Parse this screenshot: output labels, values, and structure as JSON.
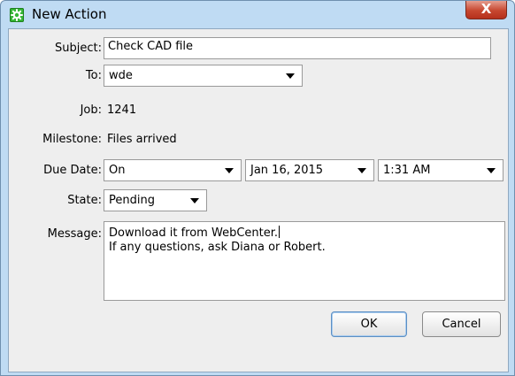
{
  "window": {
    "title": "New Action",
    "close_label": "X"
  },
  "form": {
    "subject": {
      "label": "Subject:",
      "value": "Check CAD file"
    },
    "to": {
      "label": "To:",
      "value": "wde"
    },
    "job": {
      "label": "Job:",
      "value": "1241"
    },
    "milestone": {
      "label": "Milestone:",
      "value": "Files arrived"
    },
    "due_date": {
      "label": "Due Date:",
      "mode": "On",
      "date": "Jan 16, 2015",
      "time": "1:31 AM"
    },
    "state": {
      "label": "State:",
      "value": "Pending"
    },
    "message": {
      "label": "Message:",
      "line1": "Download it from WebCenter.",
      "line2": "If any questions, ask Diana or Robert."
    }
  },
  "buttons": {
    "ok": "OK",
    "cancel": "Cancel"
  },
  "colors": {
    "frame": "#bfdbf3",
    "client": "#eeeeee",
    "close": "#c7472f",
    "app_icon": "#35b735"
  },
  "icons": {
    "app": "gear-icon",
    "close": "close-icon",
    "dropdown": "chevron-down-icon"
  }
}
